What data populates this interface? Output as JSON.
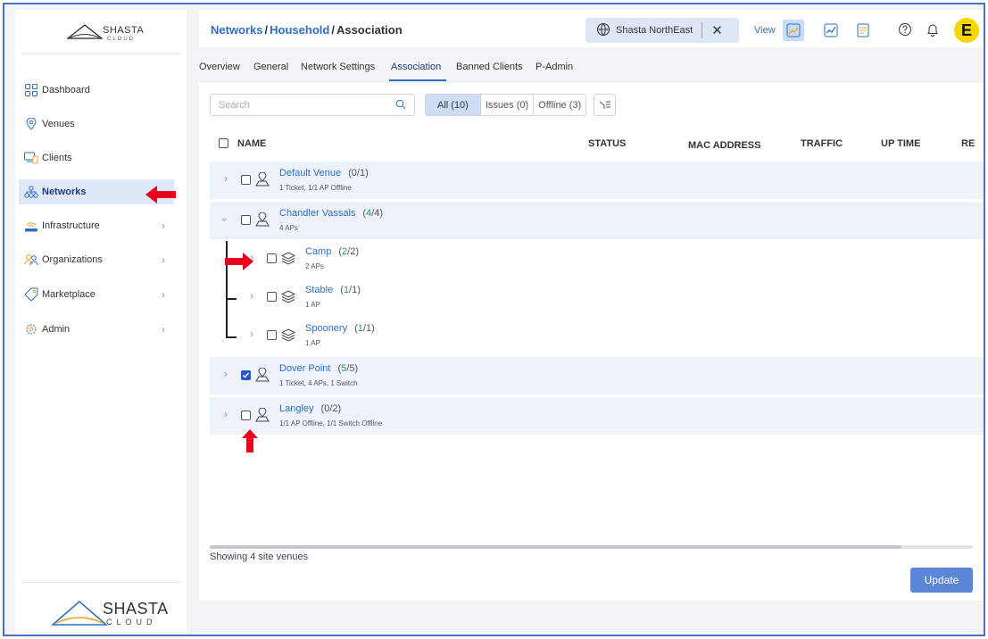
{
  "sidebar": {
    "logo_top": {
      "brand": "SHASTA",
      "sub": "CLOUD"
    },
    "items": [
      {
        "label": "Dashboard",
        "icon": "dashboard-grid-icon",
        "chevron": false,
        "active": false
      },
      {
        "label": "Venues",
        "icon": "map-pin-icon",
        "chevron": false,
        "active": false
      },
      {
        "label": "Clients",
        "icon": "devices-icon",
        "chevron": false,
        "active": false
      },
      {
        "label": "Networks",
        "icon": "network-tree-icon",
        "chevron": false,
        "active": true
      },
      {
        "label": "Infrastructure",
        "icon": "router-wifi-icon",
        "chevron": true,
        "active": false
      },
      {
        "label": "Organizations",
        "icon": "users-icon",
        "chevron": true,
        "active": false
      },
      {
        "label": "Marketplace",
        "icon": "tag-icon",
        "chevron": true,
        "active": false
      },
      {
        "label": "Admin",
        "icon": "gear-icon",
        "chevron": true,
        "active": false
      }
    ],
    "logo_bottom": {
      "brand": "SHASTA",
      "sub": "CLOUD"
    }
  },
  "header": {
    "breadcrumb": {
      "part1": "Networks",
      "sep1": "/",
      "part2": "Household",
      "sep2": "/",
      "current": "Association"
    },
    "org": {
      "name": "Shasta NorthEast",
      "close": "✕"
    },
    "view_label": "View",
    "avatar_letter": "E"
  },
  "tabs": [
    "Overview",
    "General",
    "Network Settings",
    "Association",
    "Banned Clients",
    "P-Admin"
  ],
  "active_tab": "Association",
  "toolbar": {
    "search_placeholder": "Search",
    "filters": [
      "All (10)",
      "Issues (0)",
      "Offline (3)"
    ]
  },
  "table": {
    "columns": [
      "NAME",
      "STATUS",
      "MAC ADDRESS",
      "TRAFFIC",
      "UP TIME",
      "RE"
    ],
    "rows": [
      {
        "name": "Default Venue",
        "count_open": "(",
        "count_a": "0",
        "count_sep": "/",
        "count_b": "1",
        "count_close": ")",
        "sub": "1 Ticket, 1/1 AP Offline",
        "expanded": false,
        "checked": false,
        "level": 0
      },
      {
        "name": "Chandler Vassals",
        "count_open": "(",
        "count_a": "4",
        "count_sep": "/",
        "count_b": "4",
        "count_close": ")",
        "sub": "4 APs",
        "expanded": true,
        "checked": false,
        "level": 0
      },
      {
        "name": "Camp",
        "count_open": "(",
        "count_a": "2",
        "count_sep": "/",
        "count_b": "2",
        "count_close": ")",
        "sub": "2 APs",
        "expanded": false,
        "checked": false,
        "level": 1
      },
      {
        "name": "Stable",
        "count_open": "(",
        "count_a": "1",
        "count_sep": "/",
        "count_b": "1",
        "count_close": ")",
        "sub": "1 AP",
        "expanded": false,
        "checked": false,
        "level": 1
      },
      {
        "name": "Spoonery",
        "count_open": "(",
        "count_a": "1",
        "count_sep": "/",
        "count_b": "1",
        "count_close": ")",
        "sub": "1 AP",
        "expanded": false,
        "checked": false,
        "level": 1
      },
      {
        "name": "Dover Point",
        "count_open": "(",
        "count_a": "5",
        "count_sep": "/",
        "count_b": "5",
        "count_close": ")",
        "sub": "1 Ticket, 4 APs, 1 Switch",
        "expanded": false,
        "checked": true,
        "level": 0
      },
      {
        "name": "Langley",
        "count_open": "(",
        "count_a": "0",
        "count_sep": "/",
        "count_b": "2",
        "count_close": ")",
        "sub": "1/1 AP Offline, 1/1 Switch Offline",
        "expanded": false,
        "checked": false,
        "level": 0
      }
    ]
  },
  "footer": {
    "showing": "Showing 4 site venues",
    "update_label": "Update"
  },
  "colors": {
    "accent": "#2e6ec4",
    "frame": "#4a72c4",
    "active_bg": "#dfe8f8",
    "annotation": "#e8001c",
    "online": "#2e9a4a"
  }
}
